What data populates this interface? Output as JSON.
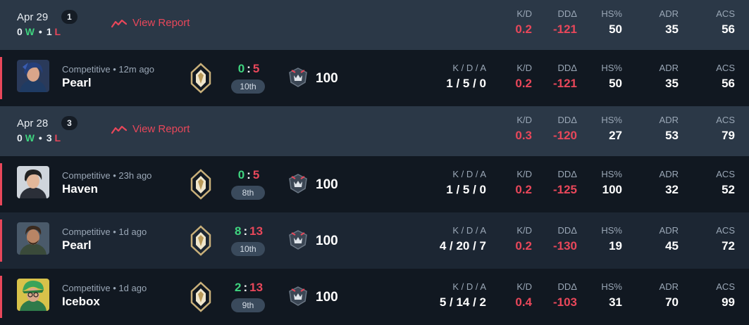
{
  "days": [
    {
      "date": "Apr 29",
      "count": "1",
      "wins": "0",
      "w_letter": "W",
      "losses": "1",
      "l_letter": "L",
      "view_report": "View Report",
      "stats": {
        "kd_label": "K/D",
        "kd": "0.2",
        "dd_label": "DDΔ",
        "dd": "-121",
        "hs_label": "HS%",
        "hs": "50",
        "adr_label": "ADR",
        "adr": "35",
        "acs_label": "ACS",
        "acs": "56"
      }
    },
    {
      "date": "Apr 28",
      "count": "3",
      "wins": "0",
      "w_letter": "W",
      "losses": "3",
      "l_letter": "L",
      "view_report": "View Report",
      "stats": {
        "kd_label": "K/D",
        "kd": "0.3",
        "dd_label": "DDΔ",
        "dd": "-120",
        "hs_label": "HS%",
        "hs": "27",
        "adr_label": "ADR",
        "adr": "53",
        "acs_label": "ACS",
        "acs": "79"
      }
    }
  ],
  "matches": [
    {
      "mode": "Competitive • 12m ago",
      "map": "Pearl",
      "score_won": "0",
      "score_sep": ":",
      "score_lost": "5",
      "placement": "10th",
      "rr": "100",
      "kda_label": "K / D / A",
      "kda": "1 / 5 / 0",
      "kd_label": "K/D",
      "kd": "0.2",
      "dd_label": "DDΔ",
      "dd": "-121",
      "hs_label": "HS%",
      "hs": "50",
      "adr_label": "ADR",
      "adr": "35",
      "acs_label": "ACS",
      "acs": "56",
      "agent": "agent-blue-hair"
    },
    {
      "mode": "Competitive • 23h ago",
      "map": "Haven",
      "score_won": "0",
      "score_sep": ":",
      "score_lost": "5",
      "placement": "8th",
      "rr": "100",
      "kda_label": "K / D / A",
      "kda": "1 / 5 / 0",
      "kd_label": "K/D",
      "kd": "0.2",
      "dd_label": "DDΔ",
      "dd": "-125",
      "hs_label": "HS%",
      "hs": "100",
      "adr_label": "ADR",
      "adr": "32",
      "acs_label": "ACS",
      "acs": "52",
      "agent": "agent-dark-hair"
    },
    {
      "mode": "Competitive • 1d ago",
      "map": "Pearl",
      "score_won": "8",
      "score_sep": ":",
      "score_lost": "13",
      "placement": "10th",
      "rr": "100",
      "kda_label": "K / D / A",
      "kda": "4 / 20 / 7",
      "kd_label": "K/D",
      "kd": "0.2",
      "dd_label": "DDΔ",
      "dd": "-130",
      "hs_label": "HS%",
      "hs": "19",
      "adr_label": "ADR",
      "adr": "45",
      "acs_label": "ACS",
      "acs": "72",
      "agent": "agent-bearded"
    },
    {
      "mode": "Competitive • 1d ago",
      "map": "Icebox",
      "score_won": "2",
      "score_sep": ":",
      "score_lost": "13",
      "placement": "9th",
      "rr": "100",
      "kda_label": "K / D / A",
      "kda": "5 / 14 / 2",
      "kd_label": "K/D",
      "kd": "0.4",
      "dd_label": "DDΔ",
      "dd": "-103",
      "hs_label": "HS%",
      "hs": "31",
      "adr_label": "ADR",
      "adr": "70",
      "acs_label": "ACS",
      "acs": "99",
      "agent": "agent-green-hat"
    }
  ],
  "colors": {
    "win": "#3fd47f",
    "loss": "#e8475a",
    "day_bg": "#2b3847",
    "row_bg": "#111821",
    "row_alt_bg": "#1c2633"
  }
}
